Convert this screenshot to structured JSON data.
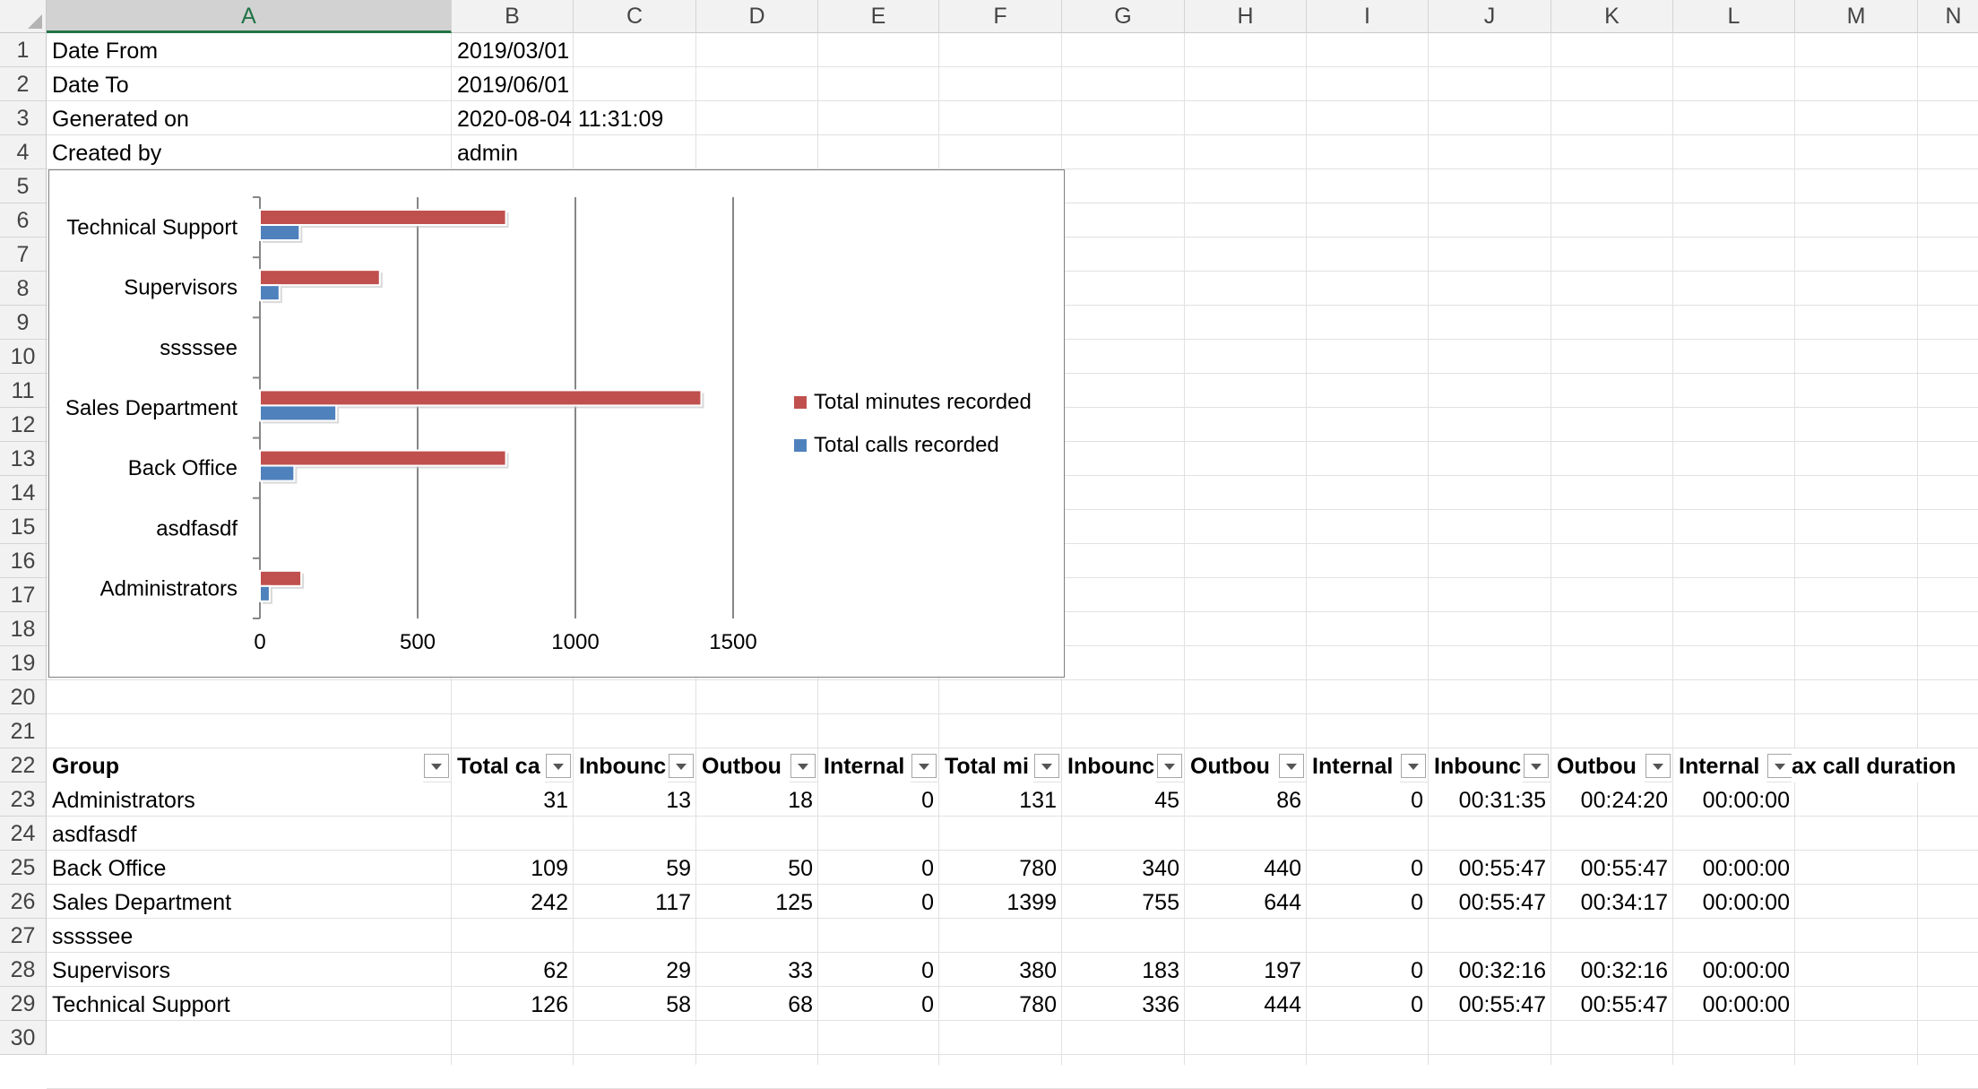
{
  "columns": [
    "A",
    "B",
    "C",
    "D",
    "E",
    "F",
    "G",
    "H",
    "I",
    "J",
    "K",
    "L",
    "M",
    "N"
  ],
  "rows": [
    "1",
    "2",
    "3",
    "4",
    "5",
    "6",
    "7",
    "8",
    "9",
    "10",
    "11",
    "12",
    "13",
    "14",
    "15",
    "16",
    "17",
    "18",
    "19",
    "20",
    "21",
    "22",
    "23",
    "24",
    "25",
    "26",
    "27",
    "28",
    "29",
    "30"
  ],
  "meta": [
    {
      "label": "Date From",
      "value": "2019/03/01"
    },
    {
      "label": "Date To",
      "value": "2019/06/01"
    },
    {
      "label": "Generated on",
      "value": "2020-08-04 11:31:09"
    },
    {
      "label": "Created by",
      "value": "admin"
    }
  ],
  "table": {
    "headers": [
      "Group",
      "Total ca",
      "Inbounc",
      "Outbou",
      "Internal",
      "Total mi",
      "Inbounc",
      "Outbou",
      "Internal",
      "Inbounc",
      "Outbou",
      "Internal",
      "ax call duration"
    ],
    "rows": [
      [
        "Administrators",
        "31",
        "13",
        "18",
        "0",
        "131",
        "45",
        "86",
        "0",
        "00:31:35",
        "00:24:20",
        "00:00:00"
      ],
      [
        "asdfasdf",
        "",
        "",
        "",
        "",
        "",
        "",
        "",
        "",
        "",
        "",
        ""
      ],
      [
        "Back Office",
        "109",
        "59",
        "50",
        "0",
        "780",
        "340",
        "440",
        "0",
        "00:55:47",
        "00:55:47",
        "00:00:00"
      ],
      [
        "Sales Department",
        "242",
        "117",
        "125",
        "0",
        "1399",
        "755",
        "644",
        "0",
        "00:55:47",
        "00:34:17",
        "00:00:00"
      ],
      [
        "sssssee",
        "",
        "",
        "",
        "",
        "",
        "",
        "",
        "",
        "",
        "",
        ""
      ],
      [
        "Supervisors",
        "62",
        "29",
        "33",
        "0",
        "380",
        "183",
        "197",
        "0",
        "00:32:16",
        "00:32:16",
        "00:00:00"
      ],
      [
        "Technical Support",
        "126",
        "58",
        "68",
        "0",
        "780",
        "336",
        "444",
        "0",
        "00:55:47",
        "00:55:47",
        "00:00:00"
      ]
    ]
  },
  "chart_data": {
    "type": "bar",
    "orientation": "horizontal",
    "categories": [
      "Technical Support",
      "Supervisors",
      "sssssee",
      "Sales Department",
      "Back Office",
      "asdfasdf",
      "Administrators"
    ],
    "series": [
      {
        "name": "Total minutes recorded",
        "color": "#c0504d",
        "values": [
          780,
          380,
          0,
          1399,
          780,
          0,
          131
        ]
      },
      {
        "name": "Total calls recorded",
        "color": "#4f81bd",
        "values": [
          126,
          62,
          0,
          242,
          109,
          0,
          31
        ]
      }
    ],
    "xticks": [
      "0",
      "500",
      "1000",
      "1500"
    ],
    "xlim": [
      0,
      1500
    ],
    "grid": true,
    "legend_position": "right"
  }
}
